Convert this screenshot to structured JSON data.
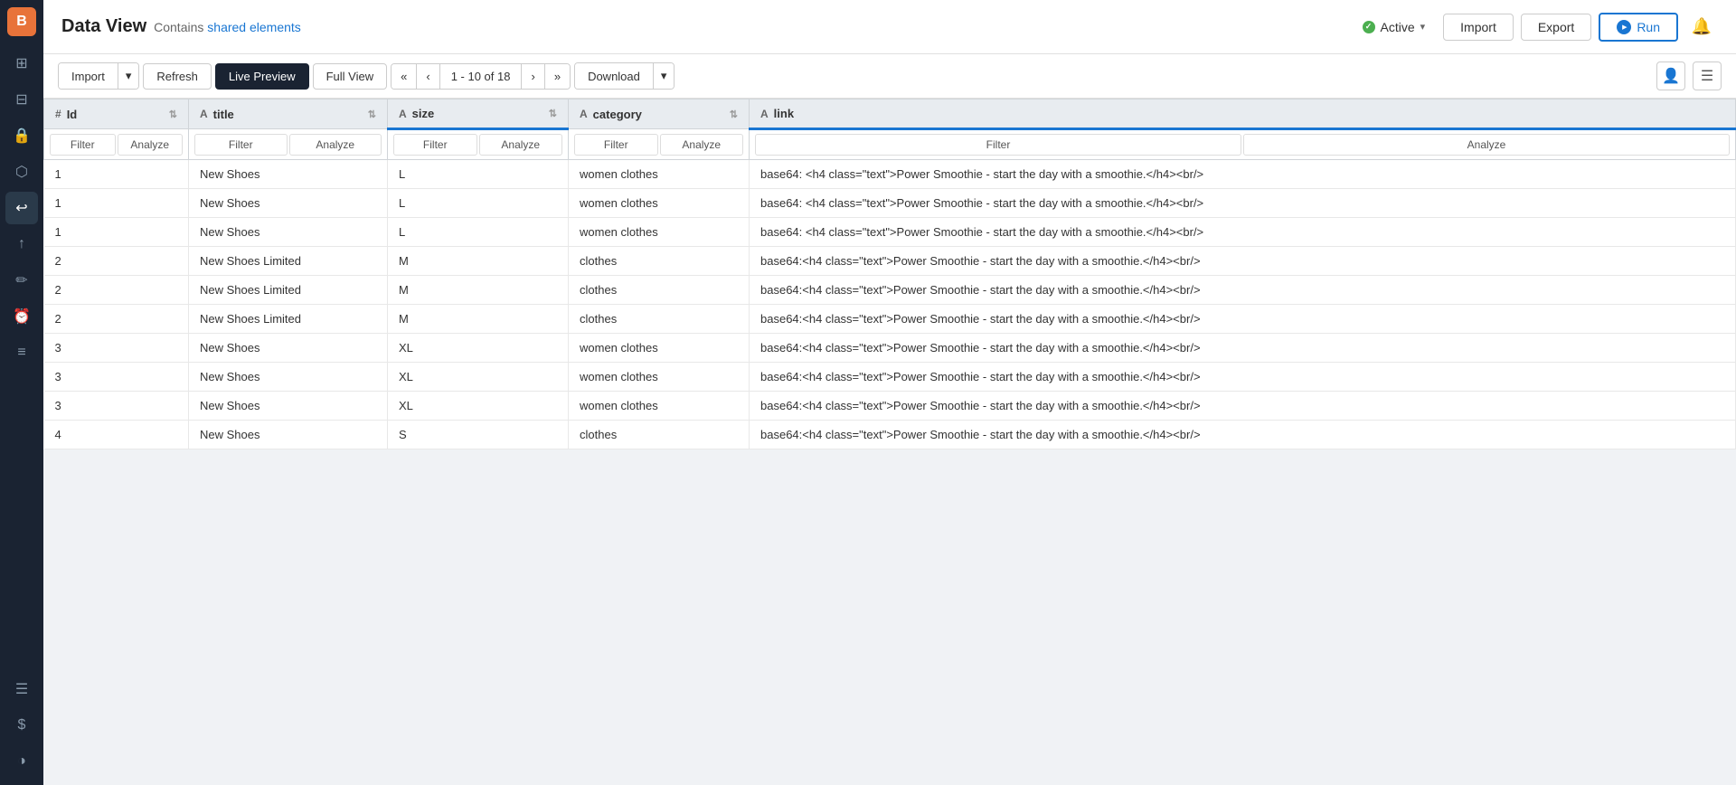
{
  "header": {
    "title": "Data View",
    "subtitle_text": "Contains",
    "subtitle_link": "shared elements",
    "status_label": "Active",
    "chevron": "▾",
    "import_label": "Import",
    "export_label": "Export",
    "run_label": "Run"
  },
  "toolbar": {
    "import_label": "Import",
    "refresh_label": "Refresh",
    "live_preview_label": "Live Preview",
    "full_view_label": "Full View",
    "first_label": "«",
    "prev_label": "‹",
    "pagination_info": "1 - 10 of 18",
    "next_label": "›",
    "last_label": "»",
    "download_label": "Download"
  },
  "columns": [
    {
      "name": "id",
      "icon": "#",
      "label": "Id"
    },
    {
      "name": "title",
      "icon": "A",
      "label": "title"
    },
    {
      "name": "size",
      "icon": "A",
      "label": "size"
    },
    {
      "name": "category",
      "icon": "A",
      "label": "category"
    },
    {
      "name": "link",
      "icon": "A",
      "label": "link"
    }
  ],
  "filter_labels": {
    "filter": "Filter",
    "analyze": "Analyze"
  },
  "rows": [
    {
      "id": "1",
      "title": "New Shoes",
      "size": "L",
      "category": "women clothes",
      "link": "base64: <h4 class=\"text\">Power Smoothie - start the day with a smoothie.</h4><br/>"
    },
    {
      "id": "1",
      "title": "New Shoes",
      "size": "L",
      "category": "women clothes",
      "link": "base64: <h4 class=\"text\">Power Smoothie - start the day with a smoothie.</h4><br/>"
    },
    {
      "id": "1",
      "title": "New Shoes",
      "size": "L",
      "category": "women clothes",
      "link": "base64: <h4 class=\"text\">Power Smoothie - start the day with a smoothie.</h4><br/>"
    },
    {
      "id": "2",
      "title": "New Shoes Limited",
      "size": "M",
      "category": "clothes",
      "link": "base64:<h4 class=\"text\">Power Smoothie - start the day with a smoothie.</h4><br/>"
    },
    {
      "id": "2",
      "title": "New Shoes Limited",
      "size": "M",
      "category": "clothes",
      "link": "base64:<h4 class=\"text\">Power Smoothie - start the day with a smoothie.</h4><br/>"
    },
    {
      "id": "2",
      "title": "New Shoes Limited",
      "size": "M",
      "category": "clothes",
      "link": "base64:<h4 class=\"text\">Power Smoothie - start the day with a smoothie.</h4><br/>"
    },
    {
      "id": "3",
      "title": "New Shoes",
      "size": "XL",
      "category": "women clothes",
      "link": "base64:<h4 class=\"text\">Power Smoothie - start the day with a smoothie.</h4><br/>"
    },
    {
      "id": "3",
      "title": "New Shoes",
      "size": "XL",
      "category": "women clothes",
      "link": "base64:<h4 class=\"text\">Power Smoothie - start the day with a smoothie.</h4><br/>"
    },
    {
      "id": "3",
      "title": "New Shoes",
      "size": "XL",
      "category": "women clothes",
      "link": "base64:<h4 class=\"text\">Power Smoothie - start the day with a smoothie.</h4><br/>"
    },
    {
      "id": "4",
      "title": "New Shoes",
      "size": "S",
      "category": "clothes",
      "link": "base64:<h4 class=\"text\">Power Smoothie - start the day with a smoothie.</h4><br/>"
    }
  ],
  "sidebar": {
    "logo": "B",
    "icons": [
      "⊞",
      "🔒",
      "⬡",
      "↩",
      "↑",
      "✏",
      "⏰",
      "≡",
      "≡",
      "$",
      "◑"
    ]
  }
}
